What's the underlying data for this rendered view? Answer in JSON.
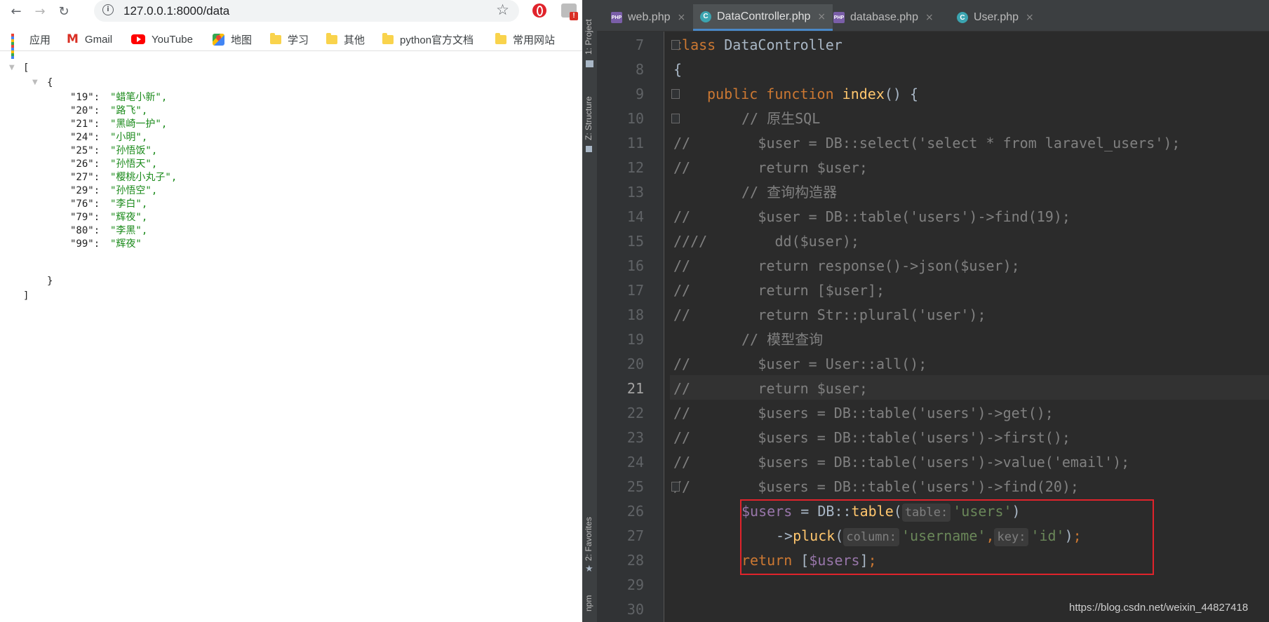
{
  "browser": {
    "url": "127.0.0.1:8000/data",
    "bookmarks": [
      {
        "label": "应用",
        "icon": "apps-icon"
      },
      {
        "label": "Gmail",
        "icon": "gmail-icon"
      },
      {
        "label": "YouTube",
        "icon": "youtube-icon"
      },
      {
        "label": "地图",
        "icon": "maps-icon"
      },
      {
        "label": "学习",
        "icon": "folder-icon"
      },
      {
        "label": "其他",
        "icon": "folder-icon"
      },
      {
        "label": "python官方文档",
        "icon": "folder-icon"
      },
      {
        "label": "常用网站",
        "icon": "folder-icon"
      }
    ],
    "json": {
      "open_bracket": "[",
      "open_brace": "{",
      "close_brace": "}",
      "close_bracket": "]",
      "entries": [
        {
          "key": "\"19\":",
          "value": "\"蜡笔小新\","
        },
        {
          "key": "\"20\":",
          "value": "\"路飞\","
        },
        {
          "key": "\"21\":",
          "value": "\"黑崎一护\","
        },
        {
          "key": "\"24\":",
          "value": "\"小明\","
        },
        {
          "key": "\"25\":",
          "value": "\"孙悟饭\","
        },
        {
          "key": "\"26\":",
          "value": "\"孙悟天\","
        },
        {
          "key": "\"27\":",
          "value": "\"樱桃小丸子\","
        },
        {
          "key": "\"29\":",
          "value": "\"孙悟空\","
        },
        {
          "key": "\"76\":",
          "value": "\"李白\","
        },
        {
          "key": "\"79\":",
          "value": "\"辉夜\","
        },
        {
          "key": "\"80\":",
          "value": "\"李黑\","
        },
        {
          "key": "\"99\":",
          "value": "\"辉夜\""
        }
      ]
    }
  },
  "ide": {
    "side_tabs": [
      "1: Project",
      "Z: Structure",
      "2: Favorites",
      "npm"
    ],
    "tabs": [
      {
        "label": "web.php",
        "type": "php",
        "active": false
      },
      {
        "label": "DataController.php",
        "type": "class",
        "active": true
      },
      {
        "label": "database.php",
        "type": "php",
        "active": false
      },
      {
        "label": "User.php",
        "type": "class",
        "active": false
      }
    ],
    "current_line": "21",
    "line_numbers": [
      "7",
      "8",
      "9",
      "10",
      "11",
      "12",
      "13",
      "14",
      "15",
      "16",
      "17",
      "18",
      "19",
      "20",
      "21",
      "22",
      "23",
      "24",
      "25",
      "26",
      "27",
      "28",
      "29",
      "30"
    ],
    "code": {
      "l7a": "class ",
      "l7b": "DataController",
      "l8": "{",
      "l9a": "public function ",
      "l9b": "index",
      "l9c": "() {",
      "l10": "// 原生SQL",
      "l11": "//        $user = DB::select('select * from laravel_users');",
      "l12": "//        return $user;",
      "l13": "// 查询构造器",
      "l14": "//        $user = DB::table('users')->find(19);",
      "l15": "////        dd($user);",
      "l16": "//        return response()->json($user);",
      "l17": "//        return [$user];",
      "l18": "//        return Str::plural('user');",
      "l19": "// 模型查询",
      "l20": "//        $user = User::all();",
      "l21": "//        return $user;",
      "l22": "//        $users = DB::table('users')->get();",
      "l23": "//        $users = DB::table('users')->first();",
      "l24": "//        $users = DB::table('users')->value('email');",
      "l25": "//        $users = DB::table('users')->find(20);",
      "l26_var": "$users",
      "l26_mid": " = DB::",
      "l26_fn": "table",
      "l26_open": "(",
      "l26_hint": "table:",
      "l26_str": "'users'",
      "l26_close": ")",
      "l27_arrow": "->",
      "l27_fn": "pluck",
      "l27_open": "(",
      "l27_hint1": "column:",
      "l27_str1": "'username'",
      "l27_comma": ",",
      "l27_hint2": "key:",
      "l27_str2": "'id'",
      "l27_close": ")",
      "l27_semi": ";",
      "l28_kw": "return ",
      "l28_open": "[",
      "l28_var": "$users",
      "l28_close": "]",
      "l28_semi": ";"
    }
  },
  "watermark": "https://blog.csdn.net/weixin_44827418"
}
